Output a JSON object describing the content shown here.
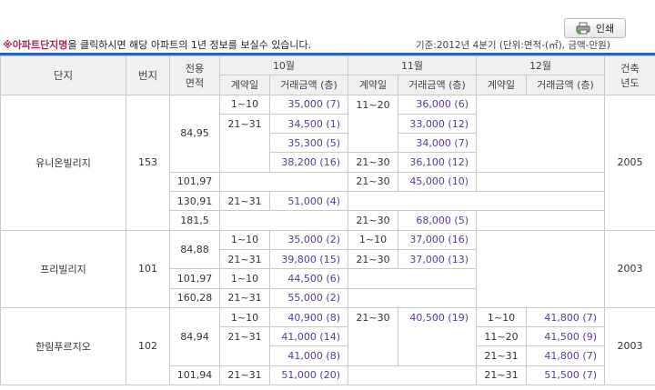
{
  "toolbar": {
    "print_label": "인쇄"
  },
  "notice": {
    "mark": "※",
    "strong": "아파트단지명",
    "rest": "을 클릭하시면 해당 아파트의 1년 정보를 보실수 있습니다.",
    "basis": "기준:2012년 4분기   (단위:면적-(㎡), 금액-만원)"
  },
  "header": {
    "complex": "단지",
    "lot": "번지",
    "area_line1": "전용",
    "area_line2": "면적",
    "months": [
      "10월",
      "11월",
      "12월"
    ],
    "period": "계약일",
    "amount": "거래금액 (층)",
    "built_line1": "건축",
    "built_line2": "년도"
  },
  "complexes": [
    {
      "name": "유니온빌리지",
      "lot": "153",
      "built": "2005",
      "rows": [
        {
          "area": "84,95",
          "c10p": "1~10",
          "c10a": "35,000 (7)",
          "c11p": "11~20",
          "c11a": "36,000 (6)",
          "c12p": "",
          "c12a": ""
        },
        {
          "area": "",
          "c10p": "21~31",
          "c10a": "34,500 (1)",
          "c11p": "",
          "c11a": "33,000 (12)",
          "c12p": "",
          "c12a": ""
        },
        {
          "area": "",
          "c10p": "",
          "c10a": "35,300 (5)",
          "c11p": "",
          "c11a": "34,000 (7)",
          "c12p": "",
          "c12a": ""
        },
        {
          "area": "",
          "c10p": "",
          "c10a": "38,200 (16)",
          "c11p": "21~30",
          "c11a": "36,100 (12)",
          "c12p": "",
          "c12a": ""
        },
        {
          "area": "101,97",
          "c10p": "",
          "c10a": "",
          "c11p": "21~30",
          "c11a": "45,000 (10)",
          "c12p": "",
          "c12a": ""
        },
        {
          "area": "130,91",
          "c10p": "21~31",
          "c10a": "51,000 (4)",
          "c11p": "",
          "c11a": "",
          "c12p": "",
          "c12a": ""
        },
        {
          "area": "181,5",
          "c10p": "",
          "c10a": "",
          "c11p": "21~30",
          "c11a": "68,000 (5)",
          "c12p": "",
          "c12a": ""
        }
      ]
    },
    {
      "name": "프리빌리지",
      "lot": "101",
      "built": "2003",
      "rows": [
        {
          "area": "84,88",
          "c10p": "1~10",
          "c10a": "35,000 (2)",
          "c11p": "1~10",
          "c11a": "37,000 (16)",
          "c12p": "",
          "c12a": ""
        },
        {
          "area": "",
          "c10p": "21~31",
          "c10a": "39,800 (15)",
          "c11p": "21~30",
          "c11a": "37,000 (13)",
          "c12p": "",
          "c12a": ""
        },
        {
          "area": "101,97",
          "c10p": "1~10",
          "c10a": "44,500 (6)",
          "c11p": "",
          "c11a": "",
          "c12p": "",
          "c12a": ""
        },
        {
          "area": "160,28",
          "c10p": "21~31",
          "c10a": "55,000 (2)",
          "c11p": "",
          "c11a": "",
          "c12p": "",
          "c12a": ""
        }
      ]
    },
    {
      "name": "한림푸르지오",
      "lot": "102",
      "built": "2003",
      "rows": [
        {
          "area": "84,94",
          "c10p": "1~10",
          "c10a": "40,900 (8)",
          "c11p": "21~30",
          "c11a": "40,500 (19)",
          "c12p": "1~10",
          "c12a": "41,800 (7)"
        },
        {
          "area": "",
          "c10p": "21~31",
          "c10a": "41,000 (14)",
          "c11p": "",
          "c11a": "",
          "c12p": "11~20",
          "c12a": "41,500 (9)"
        },
        {
          "area": "",
          "c10p": "",
          "c10a": "41,000 (8)",
          "c11p": "",
          "c11a": "",
          "c12p": "21~31",
          "c12a": "41,800 (7)"
        },
        {
          "area": "101,94",
          "c10p": "21~31",
          "c10a": "51,000 (20)",
          "c11p": "",
          "c11a": "",
          "c12p": "21~31",
          "c12a": "51,500 (7)"
        }
      ]
    }
  ]
}
